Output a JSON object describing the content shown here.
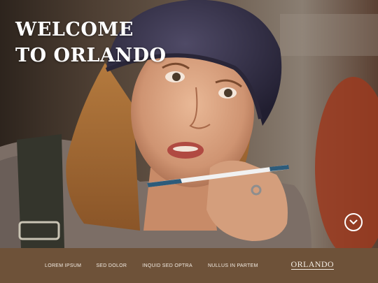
{
  "hero": {
    "headline_line1": "WELCOME",
    "headline_line2": "TO ORLANDO",
    "image_icon": "photo-woman-with-pen",
    "scroll_icon": "chevron-down-circle-icon"
  },
  "footer": {
    "nav": [
      {
        "label": "LOREM IPSUM"
      },
      {
        "label": "SED DOLOR"
      },
      {
        "label": "INQUID SED OPTRA"
      },
      {
        "label": "NULLUS IN PARTEM"
      }
    ],
    "brand": "ORLANDO"
  },
  "colors": {
    "footer_bg": "#6e5239",
    "footer_text": "#f3ece3",
    "headline_text": "#ffffff"
  }
}
